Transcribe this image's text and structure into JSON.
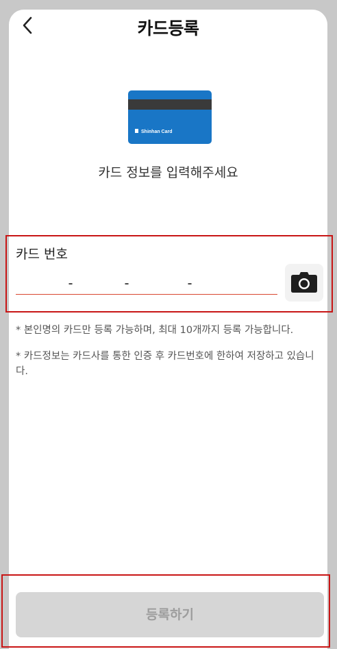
{
  "header": {
    "back_icon": "chevron-left-icon",
    "title": "카드등록"
  },
  "card_image": {
    "brand_text": "Shinhan Card",
    "color": "#1976c6"
  },
  "subtitle": "카드 정보를 입력해주세요",
  "card_number": {
    "label": "카드 번호",
    "separator": "-",
    "segments": [
      "",
      "",
      "",
      ""
    ],
    "underline_color": "#d9452f",
    "camera_icon": "camera-icon"
  },
  "notes": [
    "* 본인명의 카드만 등록 가능하며, 최대 10개까지 등록 가능합니다.",
    "* 카드정보는 카드사를 통한 인증 후 카드번호에 한하여 저장하고 있습니다."
  ],
  "register_button": {
    "label": "등록하기",
    "state": "disabled"
  },
  "highlight_color": "#c81414"
}
